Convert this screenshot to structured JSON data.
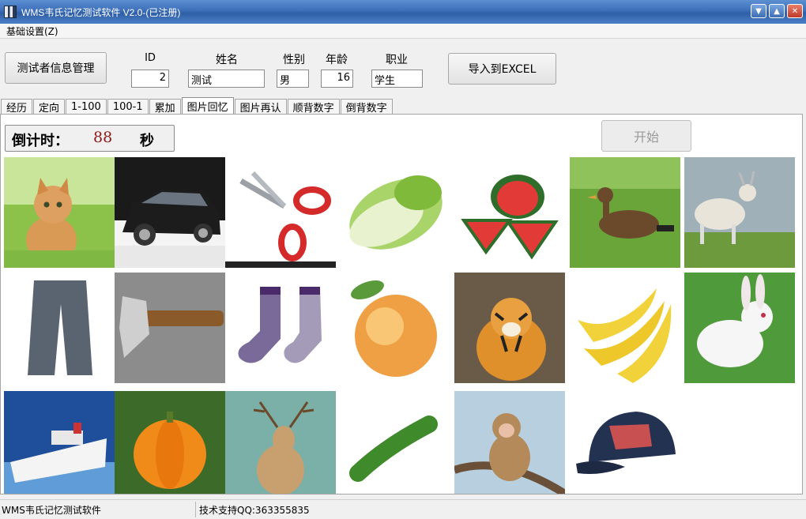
{
  "window": {
    "title": "WMS韦氏记忆测试软件 V2.0-(已注册)"
  },
  "menu": {
    "settings": "基础设置(Z)"
  },
  "form": {
    "manage_button": "测试者信息管理",
    "id_label": "ID",
    "id_value": "2",
    "name_label": "姓名",
    "name_value": "测试",
    "gender_label": "性别",
    "gender_value": "男",
    "age_label": "年龄",
    "age_value": "16",
    "job_label": "职业",
    "job_value": "学生",
    "export_button": "导入到EXCEL"
  },
  "tabs": [
    {
      "label": "经历"
    },
    {
      "label": "定向"
    },
    {
      "label": "1-100"
    },
    {
      "label": "100-1"
    },
    {
      "label": "累加"
    },
    {
      "label": "图片回忆",
      "active": true
    },
    {
      "label": "图片再认"
    },
    {
      "label": "顺背数字"
    },
    {
      "label": "倒背数字"
    }
  ],
  "countdown": {
    "label": "倒计时：",
    "value": "88",
    "unit": "秒"
  },
  "start_button": "开始",
  "images": [
    {
      "name": "kitten-image"
    },
    {
      "name": "car-image"
    },
    {
      "name": "scissors-image"
    },
    {
      "name": "cabbage-image"
    },
    {
      "name": "watermelon-image"
    },
    {
      "name": "duck-image"
    },
    {
      "name": "goat-image"
    },
    {
      "name": "pants-image"
    },
    {
      "name": "axe-image"
    },
    {
      "name": "socks-image"
    },
    {
      "name": "peach-image"
    },
    {
      "name": "tiger-image"
    },
    {
      "name": "banana-image"
    },
    {
      "name": "rabbit-image"
    },
    {
      "name": "ship-image"
    },
    {
      "name": "pumpkin-image"
    },
    {
      "name": "deer-image"
    },
    {
      "name": "cucumber-image"
    },
    {
      "name": "monkey-image"
    },
    {
      "name": "cap-image"
    }
  ],
  "status": {
    "left": "WMS韦氏记忆测试软件",
    "right": "技术支持QQ:363355835"
  }
}
